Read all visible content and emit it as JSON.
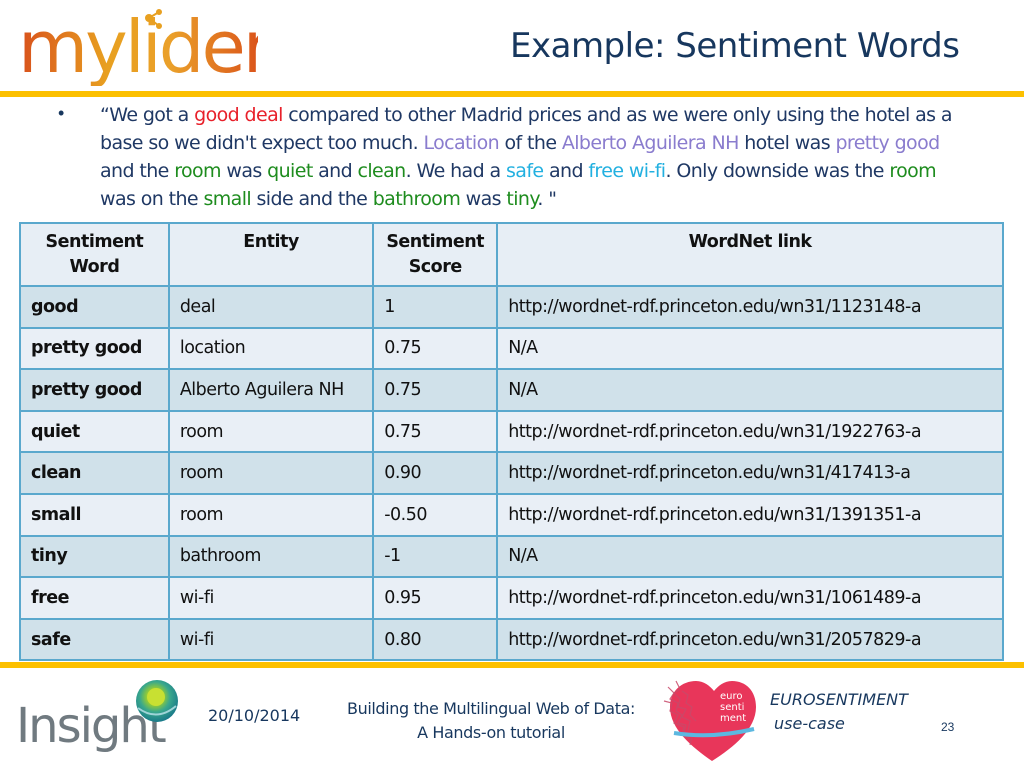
{
  "header": {
    "logo_text": "mylider",
    "title": "Example: Sentiment Words"
  },
  "quote": {
    "bullet": "•",
    "segments": [
      {
        "text": "“We got a ",
        "style": "plain"
      },
      {
        "text": "good deal",
        "style": "red"
      },
      {
        "text": " compared to other Madrid prices and as we were only using the hotel as a base so we didn't expect too much. ",
        "style": "plain"
      },
      {
        "text": "Location",
        "style": "purple"
      },
      {
        "text": " of the ",
        "style": "plain"
      },
      {
        "text": "Alberto Aguilera NH",
        "style": "purple"
      },
      {
        "text": " hotel was ",
        "style": "plain"
      },
      {
        "text": "pretty good",
        "style": "purple"
      },
      {
        "text": " and the ",
        "style": "plain"
      },
      {
        "text": "room",
        "style": "green"
      },
      {
        "text": " was ",
        "style": "plain"
      },
      {
        "text": "quiet",
        "style": "green"
      },
      {
        "text": " and ",
        "style": "plain"
      },
      {
        "text": "clean",
        "style": "green"
      },
      {
        "text": ". We had a ",
        "style": "plain"
      },
      {
        "text": "safe",
        "style": "cyan"
      },
      {
        "text": " and ",
        "style": "plain"
      },
      {
        "text": "free wi-fi",
        "style": "cyan"
      },
      {
        "text": ". Only downside was the ",
        "style": "plain"
      },
      {
        "text": "room",
        "style": "green"
      },
      {
        "text": " was on the ",
        "style": "plain"
      },
      {
        "text": "small",
        "style": "green"
      },
      {
        "text": " side and the ",
        "style": "plain"
      },
      {
        "text": "bathroom",
        "style": "green"
      },
      {
        "text": " was ",
        "style": "plain"
      },
      {
        "text": "tiny",
        "style": "green"
      },
      {
        "text": ". \"",
        "style": "plain"
      }
    ]
  },
  "colors": {
    "accent_bar": "#fcc000",
    "title": "#17375e",
    "highlight_red": "#e8202a",
    "highlight_purple": "#8a7cce",
    "highlight_green": "#1e8c1e",
    "highlight_cyan": "#22b0e0",
    "table_border": "#5aa8cd"
  },
  "table": {
    "headers": [
      "Sentiment Word",
      "Entity",
      "Sentiment Score",
      "WordNet link"
    ],
    "rows": [
      {
        "word": "good",
        "entity": "deal",
        "score": "1",
        "link": "http://wordnet-rdf.princeton.edu/wn31/1123148-a"
      },
      {
        "word": "pretty good",
        "entity": "location",
        "score": "0.75",
        "link": "N/A"
      },
      {
        "word": "pretty good",
        "entity": "Alberto Aguilera NH",
        "score": "0.75",
        "link": "N/A"
      },
      {
        "word": "quiet",
        "entity": "room",
        "score": "0.75",
        "link": "http://wordnet-rdf.princeton.edu/wn31/1922763-a"
      },
      {
        "word": "clean",
        "entity": "room",
        "score": "0.90",
        "link": "http://wordnet-rdf.princeton.edu/wn31/417413-a"
      },
      {
        "word": "small",
        "entity": "room",
        "score": "-0.50",
        "link": "http://wordnet-rdf.princeton.edu/wn31/1391351-a"
      },
      {
        "word": "tiny",
        "entity": "bathroom",
        "score": "-1",
        "link": "N/A"
      },
      {
        "word": "free",
        "entity": "wi-fi",
        "score": "0.95",
        "link": "http://wordnet-rdf.princeton.edu/wn31/1061489-a"
      },
      {
        "word": "safe",
        "entity": "wi-fi",
        "score": "0.80",
        "link": "http://wordnet-rdf.princeton.edu/wn31/2057829-a"
      }
    ]
  },
  "footer": {
    "insight_logo_text": "Insight",
    "date": "20/10/2014",
    "title_line1": "Building the Multilingual Web of Data:",
    "title_line2": "A Hands-on tutorial",
    "heart_logo_text": [
      "euro",
      "senti",
      "ment"
    ],
    "project": "EUROSENTIMENT",
    "subtitle": "use-case",
    "page_number": "23"
  }
}
